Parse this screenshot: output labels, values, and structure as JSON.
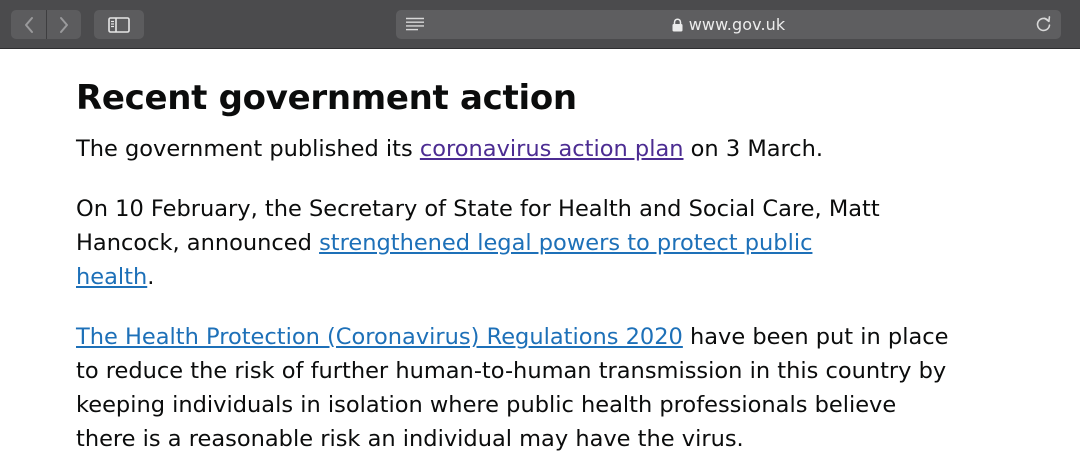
{
  "browser": {
    "url": "www.gov.uk",
    "icons": {
      "back": "chevron-left-icon",
      "forward": "chevron-right-icon",
      "sidebar": "sidebar-icon",
      "reader": "reader-view-icon",
      "lock": "lock-icon",
      "reload": "reload-icon"
    }
  },
  "page": {
    "heading": "Recent government action",
    "p1": {
      "before": "The government published its ",
      "link": "coronavirus action plan",
      "after": " on 3 March."
    },
    "p2": {
      "before": "On 10 February, the Secretary of State for Health and Social Care, Matt Hancock, announced ",
      "link": "strengthened legal powers to protect public health",
      "after": "."
    },
    "p3": {
      "link": "The Health Protection (Coronavirus) Regulations 2020",
      "after": " have been put in place to reduce the risk of further human-to-human transmission in this country by keeping individuals in isolation where public health professionals believe there is a reasonable risk an individual may have the virus."
    }
  },
  "colors": {
    "toolbar": "#4b4b4d",
    "text": "#0b0c0c",
    "link": "#1d70b8",
    "visited_link": "#4c2c92"
  }
}
